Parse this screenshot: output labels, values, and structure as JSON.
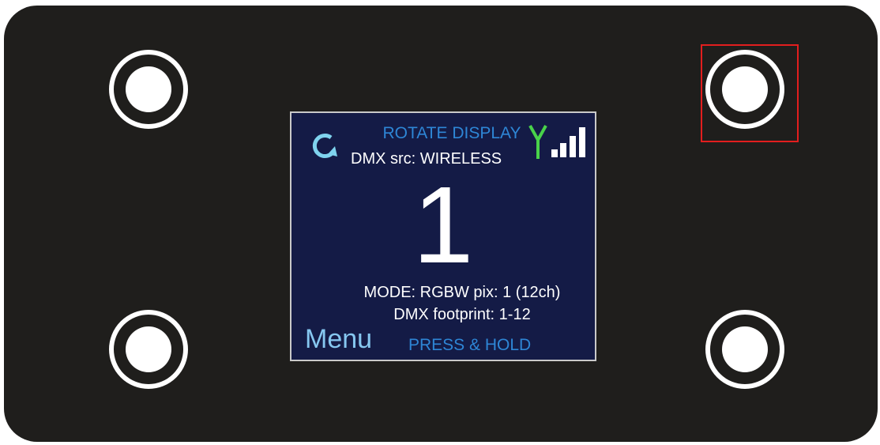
{
  "display": {
    "rotate_label": "ROTATE DISPLAY",
    "dmx_source": "DMX src: WIRELESS",
    "address": "1",
    "mode": "MODE: RGBW pix: 1 (12ch)",
    "footprint": "DMX footprint: 1-12",
    "menu_label": "Menu",
    "hold_label": "PRESS & HOLD",
    "signal_level_bars": 4,
    "signal_max_bars": 4
  },
  "controls": {
    "highlighted_button": "top-right-button"
  },
  "icons": {
    "rotate": "rotate-icon",
    "antenna": "antenna-icon",
    "signal": "signal-strength-icon"
  },
  "colors": {
    "panel": "#1f1e1c",
    "screen": "#141b46",
    "accent_blue": "#2e86d6",
    "menu_blue": "#86c7f0",
    "antenna_green": "#49d24a",
    "rotate_cyan": "#7fd3ee",
    "highlight_red": "#e21e1e"
  }
}
